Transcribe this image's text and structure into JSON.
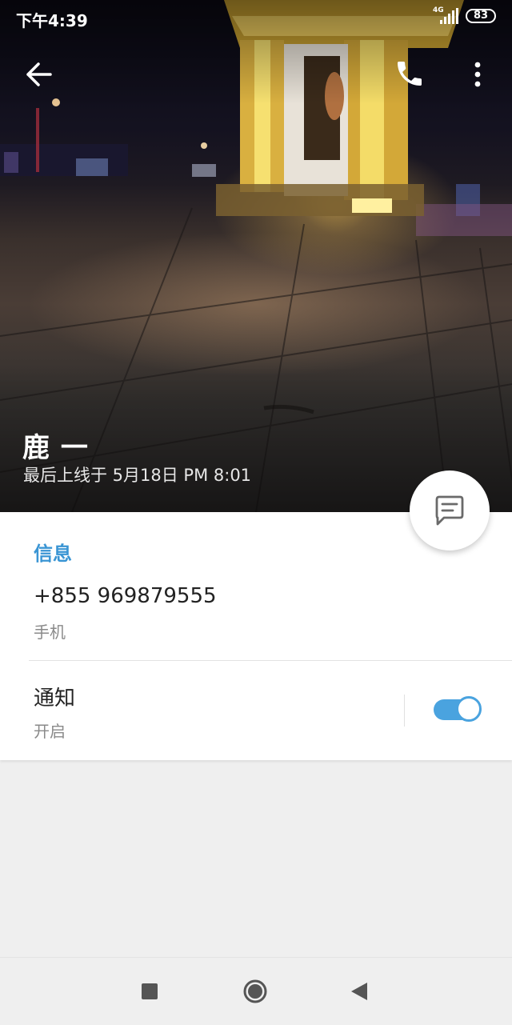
{
  "status_bar": {
    "time": "下午4:39",
    "network": "4G",
    "battery": "83"
  },
  "toolbar": {
    "back_icon": "arrow-left-icon",
    "call_icon": "phone-icon",
    "more_icon": "more-vertical-icon"
  },
  "profile": {
    "name": "鹿 一",
    "last_seen": "最后上线于 5月18日 PM 8:01"
  },
  "fab": {
    "icon": "message-icon"
  },
  "info": {
    "section_title": "信息",
    "phone": "+855 969879555",
    "phone_label": "手机",
    "notifications_title": "通知",
    "notifications_state": "开启",
    "notifications_enabled": true
  },
  "colors": {
    "accent": "#3a95d4",
    "toggle": "#4aa3df",
    "background": "#efefef"
  },
  "nav_bar": {
    "recents_icon": "square-icon",
    "home_icon": "home-circle-icon",
    "back_icon": "triangle-back-icon"
  }
}
